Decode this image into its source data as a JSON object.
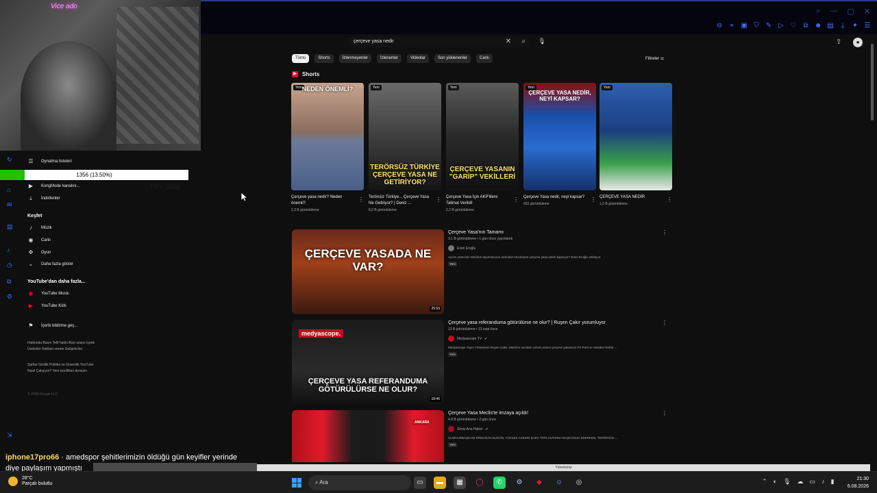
{
  "webcam": {
    "neon_text": "Vice ado"
  },
  "progress": {
    "text": "1356 (13.50%)",
    "fraction": 0.135
  },
  "ghost_text": {
    "a": "TRY 1000"
  },
  "guide": {
    "items_top": [
      {
        "icon": "playlist-icon",
        "label": "Oynatma listeleri"
      },
      {
        "icon": "video-icon",
        "label": "KongMode kanalını..."
      },
      {
        "icon": "download-icon",
        "label": "İndirilenler"
      }
    ],
    "explore_heading": "Keşfet",
    "explore": [
      {
        "icon": "music-icon",
        "label": "Müzik"
      },
      {
        "icon": "live-icon",
        "label": "Canlı"
      },
      {
        "icon": "game-icon",
        "label": "Oyun"
      },
      {
        "icon": "chevron-down-icon",
        "label": "Daha fazla göster"
      }
    ],
    "more_heading": "YouTube'dan daha fazla...",
    "more": [
      {
        "icon": "yt-music-icon",
        "label": "YouTube Music"
      },
      {
        "icon": "yt-kids-icon",
        "label": "YouTube Kids"
      }
    ],
    "report": "İçerik bildirme geç...",
    "footer1": "Hakkında  Basın  Telif hakkı  Bize ulaşın  İçerik Üreticiler  Reklam verme  Geliştiriciler",
    "footer2": "Şartlar  Gizlilik  Politika ve Güvenlik  YouTube Nasıl Çalışıyor?  Yeni özellikleri deneyin",
    "copyright": "© 2026 Google LLC"
  },
  "search": {
    "query": "çerçeve yasa nedir"
  },
  "chips": [
    "Tümü",
    "Shorts",
    "İzlenmeyenler",
    "İzlenenler",
    "Videolar",
    "Son yüklenenler",
    "Canlı"
  ],
  "filters_label": "Filtreler",
  "shorts": {
    "heading": "Shorts",
    "items": [
      {
        "badge": "Yeni",
        "caption": "NEDEN ÖNEMLİ?",
        "title": "Çerçeve yasa nedir? Neden önemli?",
        "views": "2,3 B görüntüleme",
        "color": "#c9a48a"
      },
      {
        "badge": "Yeni",
        "caption": "TERÖRSÜZ TÜRKİYE ÇERÇEVE YASA NE GETİRİYOR?",
        "title": "Terörsüz Türkiye... Çerçeve Yasa Ne Getiriyor? | Deniz ...",
        "views": "8,3 B görüntüleme",
        "color": "#3a3a3a"
      },
      {
        "badge": "Yeni",
        "caption": "ÇERÇEVE YASANIN \"GARİP\" VEKİLLERİ",
        "title": "Çerçeve Yasa İçin AKP'lilere Talimat Verildi!",
        "views": "2,2 B görüntüleme",
        "color": "#2a2a2a"
      },
      {
        "badge": "Yeni",
        "caption": "ÇERÇEVE YASA NEDİR, NEYİ KAPSAR?",
        "title": "Çerçeve Yasa nedir, neyi kapsar?",
        "views": "663 görüntüleme",
        "color": "#1a4fa8"
      },
      {
        "badge": "Yeni",
        "caption": "",
        "title": "ÇERÇEVE YASA NEDİR",
        "views": "1,2 B görüntüleme",
        "color": "#2d5fb0"
      }
    ]
  },
  "videos": [
    {
      "title": "Çerçeve Yasa'nın Tamamı",
      "meta": "3,1 B görüntüleme • 1 gün önce yayınlandı",
      "channel": "Ersin Eroğlu",
      "desc": "Açılım sürecinin Meclis'e taşınmasının ardından hazırlanan çerçeve yasa neleri kapsıyor? Ersin Eroğlu anlatıyor.",
      "badge": "Yeni",
      "duration": "25:59",
      "thumb_text": "ÇERÇEVE YASADA NE VAR?"
    },
    {
      "title": "Çerçeve yasa referanduma götürülürse ne olur? | Ruşen Çakır yorumluyor",
      "meta": "13 B görüntüleme • 13 saat önce",
      "channel": "Medyascope TV",
      "desc": "Medyascope Yayın Yönetmeni Ruşen Çakır, Meclis'e sunulan çözüm süreci çerçeve yasasının İYİ Parti ve Yeniden Refah ...",
      "badge": "Yeni",
      "duration": "18:46",
      "thumb_brand": "medyascope.",
      "thumb_text": "ÇERÇEVE YASA REFERANDUMA GÖTÜRÜLÜRSE NE OLUR?"
    },
    {
      "title": "Çerçeve Yasa Meclis'te imzaya açıldı!",
      "meta": "4,8 B görüntüleme • 2 gün önce",
      "channel": "Show Ana Haber",
      "desc": "CUMHURBAŞKANI ERDOĞAN BUGÜN, YÜKSEK ASKERİ ŞURA TOPLANTISINA BAŞKANLIK EDERKEN, TERÖRSÜZ ...",
      "badge": "Yeni",
      "thumb_tag": "ANKARA"
    }
  ],
  "chat": {
    "user": "iphone17pro66",
    "message1": " · amedspor şehitlerimizin öldüğü gün keyifler yerinde",
    "message2": "diye paylaşım yapmıştı"
  },
  "strip_text": "Yöneticiniz",
  "taskbar": {
    "weather_temp": "28°C",
    "weather_desc": "Parçalı bulutlu",
    "search": "Ara",
    "time": "21:30",
    "date": "6.08.2026"
  },
  "colors": {
    "accent": "#3a6cff",
    "brand": "#ff0033",
    "progress": "#22c000"
  }
}
